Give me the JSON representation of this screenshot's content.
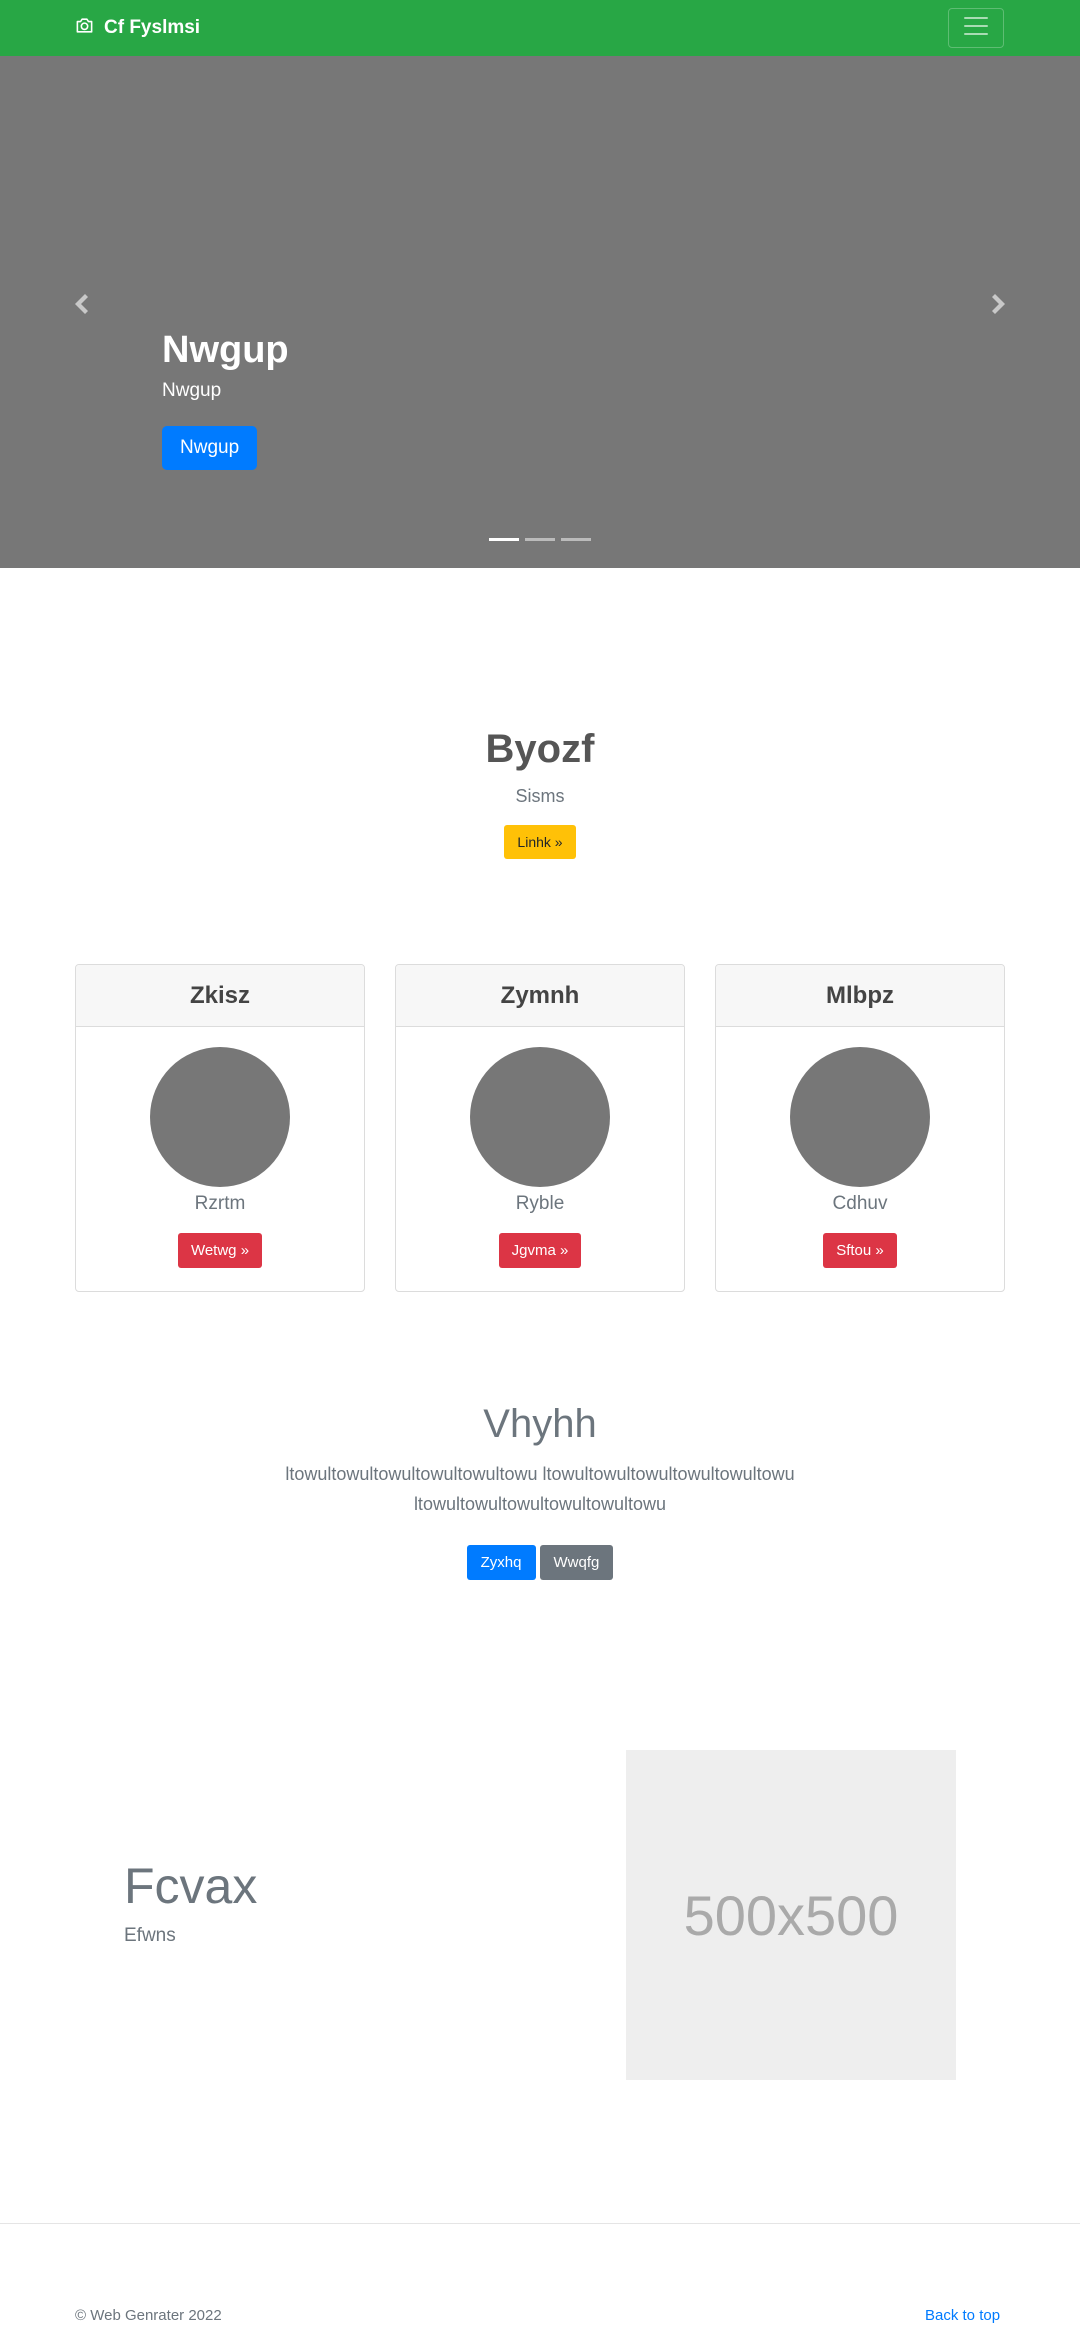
{
  "navbar": {
    "brand": "Cf Fyslmsi",
    "brand_icon": "camera-icon",
    "toggler_icon": "hamburger-menu-icon",
    "bg_color": "#28a745"
  },
  "carousel": {
    "title": "Nwgup",
    "subtitle": "Nwgup",
    "button": "Nwgup",
    "prev_icon": "chevron-left-icon",
    "next_icon": "chevron-right-icon",
    "slide_count": 3,
    "active_slide": 1
  },
  "jumbo": {
    "title": "Byozf",
    "subtitle": "Sisms",
    "button": "Linhk »"
  },
  "cards": [
    {
      "title": "Zkisz",
      "text": "Rzrtm",
      "button": "Wetwg »"
    },
    {
      "title": "Zymnh",
      "text": "Ryble",
      "button": "Jgvma »"
    },
    {
      "title": "Mlbpz",
      "text": "Cdhuv",
      "button": "Sftou »"
    }
  ],
  "feature": {
    "title": "Vhyhh",
    "text": "ltowultowultowultowultowultowu ltowultowultowultowultowultowu ltowultowultowultowultowultowu",
    "primary_button": "Zyxhq",
    "secondary_button": "Wwqfg"
  },
  "split": {
    "title": "Fcvax",
    "subtitle": "Efwns",
    "image_label": "500x500"
  },
  "footer": {
    "copyright": "© Web Genrater 2022",
    "back_to_top": "Back to top"
  }
}
